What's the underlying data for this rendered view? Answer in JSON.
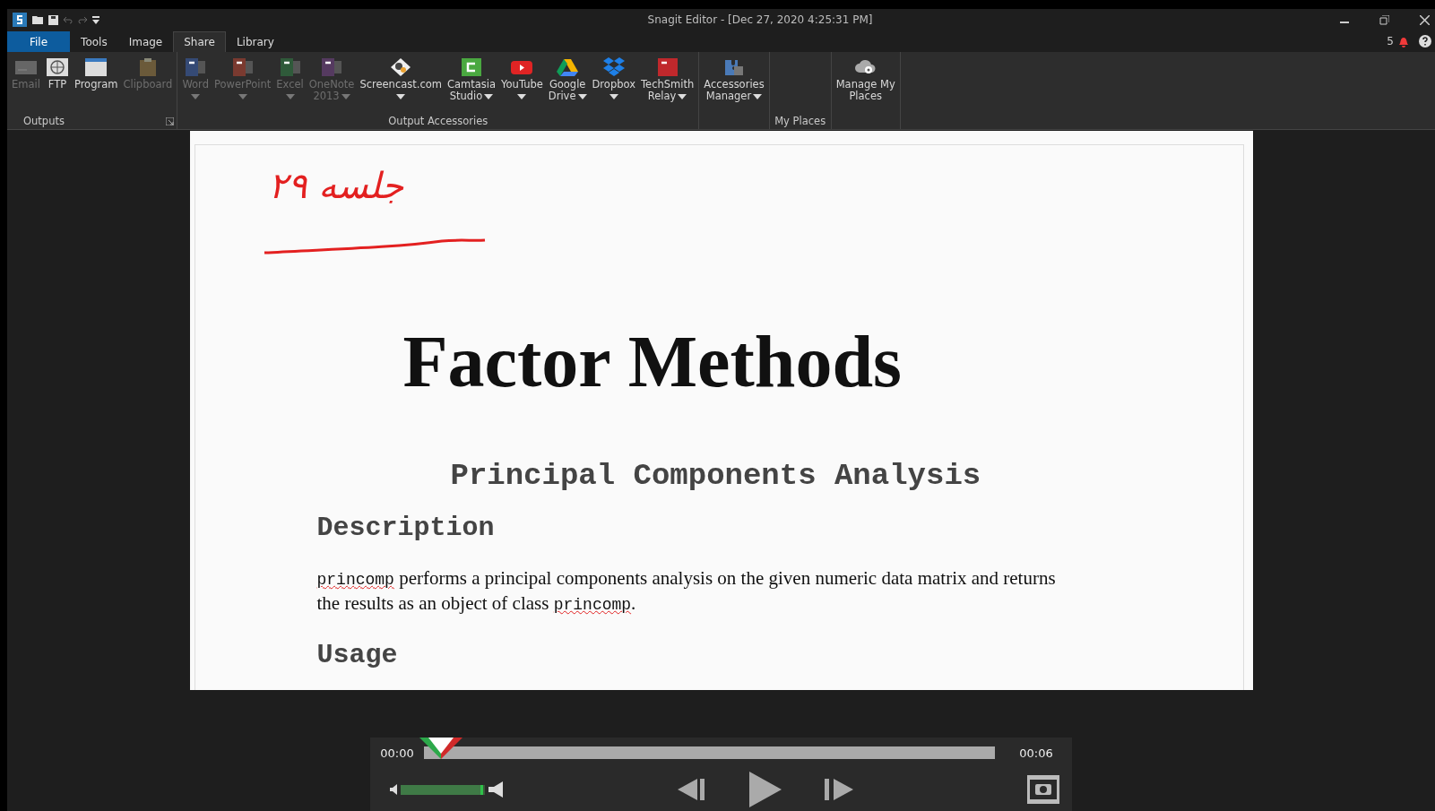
{
  "window": {
    "title": "Snagit Editor - [Dec 27, 2020 4:25:31 PM]",
    "notification_count": "5"
  },
  "tabs": [
    {
      "label": "File",
      "selected": false,
      "kind": "file"
    },
    {
      "label": "Tools",
      "selected": false,
      "kind": "tab"
    },
    {
      "label": "Image",
      "selected": false,
      "kind": "tab"
    },
    {
      "label": "Share",
      "selected": true,
      "kind": "tab"
    },
    {
      "label": "Library",
      "selected": false,
      "kind": "tab"
    }
  ],
  "ribbon": [
    {
      "label": "Outputs",
      "launcher": true,
      "items": [
        {
          "label": "Email",
          "kind": "email",
          "disabled": true
        },
        {
          "label": "FTP",
          "kind": "globe",
          "disabled": false
        },
        {
          "label": "Program",
          "kind": "window",
          "disabled": false
        },
        {
          "label": "Clipboard",
          "kind": "clipboard",
          "disabled": true
        }
      ]
    },
    {
      "label": "Output Accessories",
      "items": [
        {
          "label": "Word",
          "kind": "word",
          "disabled": true,
          "dropdown": true
        },
        {
          "label": "PowerPoint",
          "kind": "powerpoint",
          "disabled": true,
          "dropdown": true
        },
        {
          "label": "Excel",
          "kind": "excel",
          "disabled": true,
          "dropdown": true
        },
        {
          "label": "OneNote 2013",
          "kind": "onenote",
          "disabled": true,
          "dropdown": true
        },
        {
          "label": "Screencast.com",
          "kind": "screencast",
          "disabled": false,
          "dropdown": true
        },
        {
          "label": "Camtasia Studio",
          "kind": "camtasia",
          "disabled": false,
          "dropdown": true
        },
        {
          "label": "YouTube",
          "kind": "youtube",
          "disabled": false,
          "dropdown": true
        },
        {
          "label": "Google Drive",
          "kind": "drive",
          "disabled": false,
          "dropdown": true
        },
        {
          "label": "Dropbox",
          "kind": "dropbox",
          "disabled": false,
          "dropdown": true
        },
        {
          "label": "TechSmith Relay",
          "kind": "relay",
          "disabled": false,
          "dropdown": true
        }
      ]
    },
    {
      "items": [
        {
          "label": "Accessories Manager",
          "kind": "puzzle",
          "disabled": false,
          "dropdown": true
        }
      ]
    },
    {
      "label": "My Places"
    },
    {
      "items": [
        {
          "label": "Manage My Places",
          "kind": "cloud",
          "disabled": false
        }
      ]
    }
  ],
  "document": {
    "handwriting": "جلسه ۲۹",
    "title": "Factor Methods",
    "subtitle": "Principal Components Analysis",
    "sections": [
      {
        "heading": "Description",
        "paragraph": [
          {
            "kind": "code",
            "text": "princomp"
          },
          {
            "kind": "plain",
            "text": " performs a principal components analysis on the given numeric data matrix and returns the results as an object of class "
          },
          {
            "kind": "code",
            "text": "princomp"
          },
          {
            "kind": "plain",
            "text": "."
          }
        ]
      },
      {
        "heading": "Usage"
      }
    ]
  },
  "player": {
    "current_time": "00:00",
    "total_time": "00:06",
    "position": {
      "level": 0.03
    },
    "volume": {
      "level": 0.98
    }
  }
}
